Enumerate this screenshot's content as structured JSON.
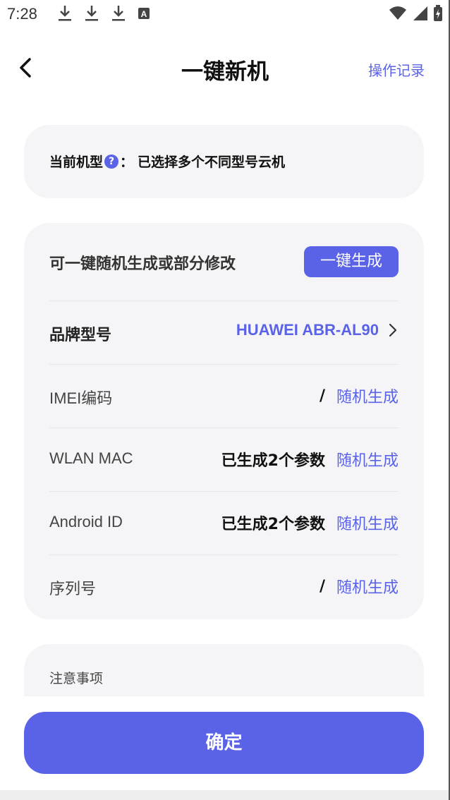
{
  "status_bar": {
    "time": "7:28",
    "left_icons": [
      "download-icon",
      "download-icon",
      "download-icon",
      "keyboard-a-icon"
    ],
    "right_icons": [
      "wifi-icon",
      "signal-icon",
      "battery-icon"
    ]
  },
  "header": {
    "title": "一键新机",
    "history_label": "操作记录"
  },
  "model_card": {
    "label": "当前机型",
    "help_icon_text": "?",
    "separator": "：",
    "value": "已选择多个不同型号云机"
  },
  "params_card": {
    "description": "可一键随机生成或部分修改",
    "generate_all_label": "一键生成",
    "rows": [
      {
        "label": "品牌型号",
        "value": "HUAWEI ABR-AL90",
        "action": ""
      },
      {
        "label": "IMEI编码",
        "value": "/",
        "action": "随机生成"
      },
      {
        "label": "WLAN MAC",
        "value": "已生成2个参数",
        "action": "随机生成"
      },
      {
        "label": "Android ID",
        "value": "已生成2个参数",
        "action": "随机生成"
      },
      {
        "label": "序列号",
        "value": "/",
        "action": "随机生成"
      }
    ]
  },
  "notes": {
    "title": "注意事项"
  },
  "footer": {
    "confirm_label": "确定"
  },
  "colors": {
    "accent": "#5a63e8",
    "card_bg": "#f5f5f7"
  }
}
